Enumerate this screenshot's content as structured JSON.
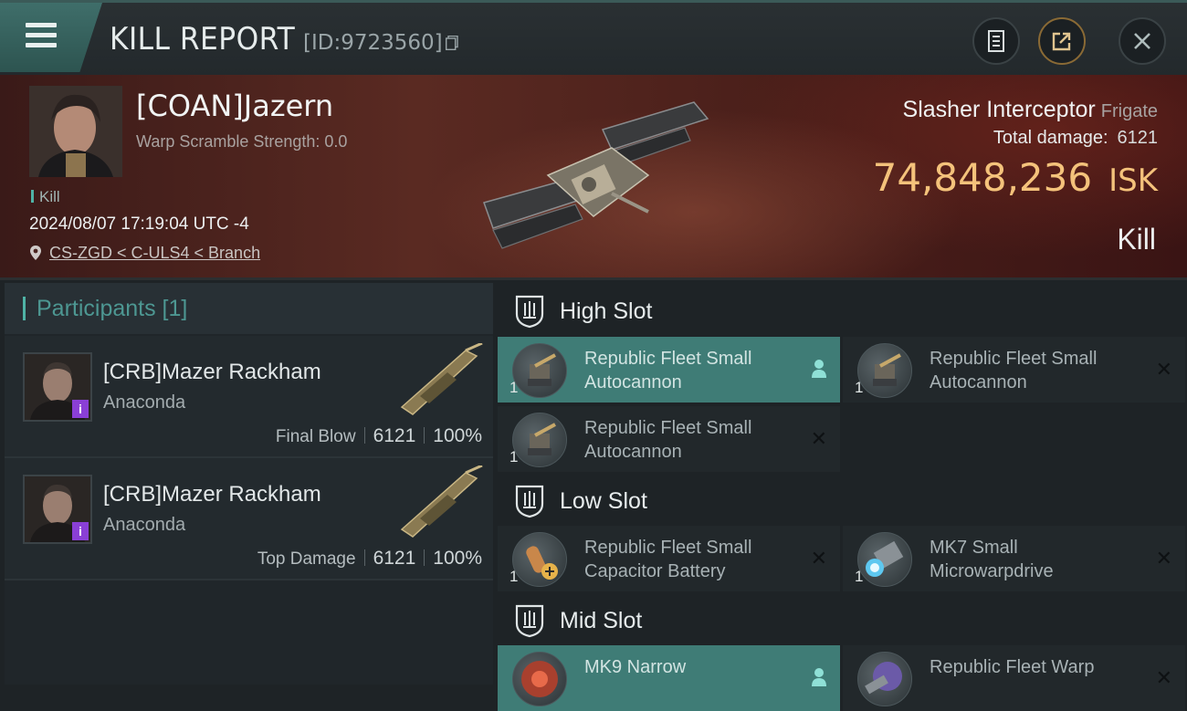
{
  "header": {
    "title": "KILL REPORT",
    "report_id": "[ID:9723560]",
    "icons": [
      "menu-icon",
      "copy-icon",
      "document-icon",
      "share-icon",
      "close-icon"
    ]
  },
  "victim": {
    "name": "[COAN]Jazern",
    "warp_scramble": "Warp Scramble Strength: 0.0",
    "type_tag": "Kill",
    "datetime": "2024/08/07 17:19:04 UTC -4",
    "location": "CS-ZGD < C-ULS4 < Branch",
    "ship_name": "Slasher Interceptor",
    "ship_class": "Frigate",
    "total_damage_label": "Total damage:",
    "total_damage": "6121",
    "isk_value": "74,848,236",
    "isk_unit": "ISK",
    "result": "Kill"
  },
  "participants": {
    "header": "Participants [1]",
    "rows": [
      {
        "name": "[CRB]Mazer Rackham",
        "ship": "Anaconda",
        "role": "Final Blow",
        "damage": "6121",
        "percent": "100%",
        "badge": "i"
      },
      {
        "name": "[CRB]Mazer Rackham",
        "ship": "Anaconda",
        "role": "Top Damage",
        "damage": "6121",
        "percent": "100%",
        "badge": "i"
      }
    ]
  },
  "fitting": {
    "high_slot": {
      "label": "High Slot",
      "modules": [
        {
          "line1": "Republic Fleet Small",
          "line2": "Autocannon",
          "qty": "1",
          "highlighted": true,
          "action": "person-icon"
        },
        {
          "line1": "Republic Fleet Small",
          "line2": "Autocannon",
          "qty": "1",
          "highlighted": false,
          "action": "x-icon"
        },
        {
          "line1": "Republic Fleet Small",
          "line2": "Autocannon",
          "qty": "1",
          "highlighted": false,
          "action": "x-icon"
        }
      ]
    },
    "low_slot": {
      "label": "Low Slot",
      "modules": [
        {
          "line1": "Republic Fleet Small",
          "line2": "Capacitor Battery",
          "qty": "1",
          "highlighted": false,
          "action": "x-icon"
        },
        {
          "line1": "MK7 Small",
          "line2": "Microwarpdrive",
          "qty": "1",
          "highlighted": false,
          "action": "x-icon"
        }
      ]
    },
    "mid_slot": {
      "label": "Mid Slot",
      "modules": [
        {
          "line1": "MK9 Narrow",
          "line2": "",
          "qty": "",
          "highlighted": true,
          "action": "person-icon"
        },
        {
          "line1": "Republic Fleet Warp",
          "line2": "",
          "qty": "",
          "highlighted": false,
          "action": "x-icon"
        }
      ]
    },
    "close_glyph": "✕"
  },
  "colors": {
    "accent": "#4fb3a6",
    "isk": "#f4c27b",
    "highlight": "#3f7c76",
    "badge": "#8a3fd6"
  }
}
